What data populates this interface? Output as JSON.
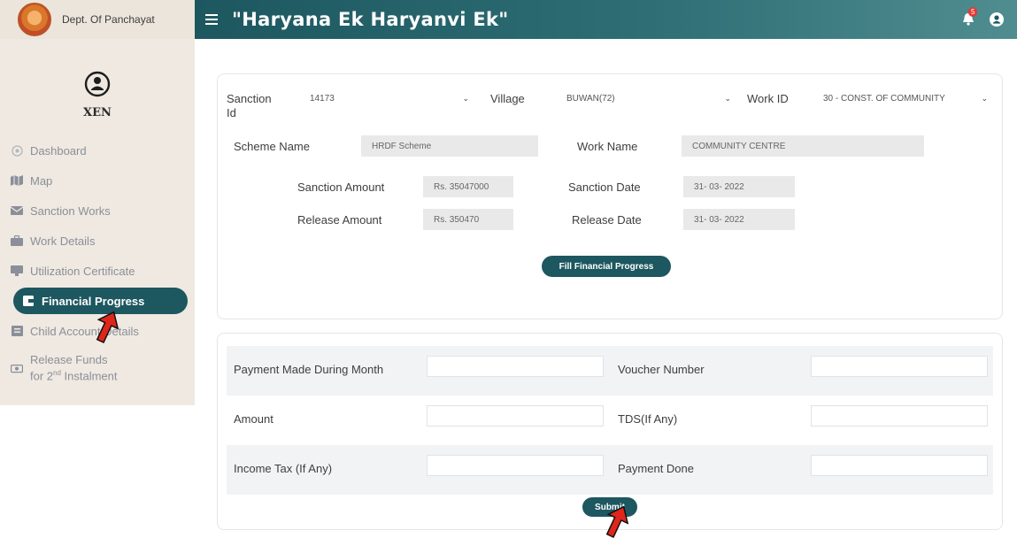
{
  "sidebar": {
    "dept": "Dept. Of Panchayat",
    "role": "XEN",
    "items": [
      {
        "label": "Dashboard",
        "icon": "dashboard-icon"
      },
      {
        "label": "Map",
        "icon": "map-icon"
      },
      {
        "label": "Sanction Works",
        "icon": "envelope-icon"
      },
      {
        "label": "Work Details",
        "icon": "briefcase-icon"
      },
      {
        "label": "Utilization Certificate",
        "icon": "monitor-icon"
      },
      {
        "label": "Financial Progress",
        "icon": "wallet-icon",
        "active": true
      },
      {
        "label": "Child Account Details",
        "icon": "id-card-icon"
      },
      {
        "label_line1": "Release Funds",
        "label_line2_pre": "for 2",
        "label_line2_sup": "nd",
        "label_line2_post": " Instalment",
        "icon": "money-icon"
      }
    ]
  },
  "header": {
    "title": "\"Haryana Ek Haryanvi Ek\"",
    "notification_count": "5"
  },
  "form": {
    "sanction_id_label": "Sanction Id",
    "sanction_id_value": "14173",
    "village_label": "Village",
    "village_value": "BUWAN(72)",
    "work_id_label": "Work ID",
    "work_id_value": "30 - CONST. OF COMMUNITY",
    "scheme_name_label": "Scheme Name",
    "scheme_name_value": "HRDF Scheme",
    "work_name_label": "Work Name",
    "work_name_value": "COMMUNITY CENTRE",
    "sanction_amount_label": "Sanction Amount",
    "sanction_amount_value": "Rs. 35047000",
    "sanction_date_label": "Sanction Date",
    "sanction_date_value": "31- 03- 2022",
    "release_amount_label": "Release Amount",
    "release_amount_value": "Rs. 350470",
    "release_date_label": "Release Date",
    "release_date_value": "31- 03- 2022",
    "fill_button": "Fill Financial Progress"
  },
  "progress": {
    "payment_month_label": "Payment Made During Month",
    "voucher_label": "Voucher Number",
    "amount_label": "Amount",
    "tds_label": "TDS(If Any)",
    "income_tax_label": "Income Tax (If Any)",
    "payment_done_label": "Payment Done",
    "submit_button": "Submit"
  },
  "colors": {
    "primary": "#1d5760",
    "sidebar_bg": "#efe9e1",
    "arrow": "#e0261b"
  }
}
